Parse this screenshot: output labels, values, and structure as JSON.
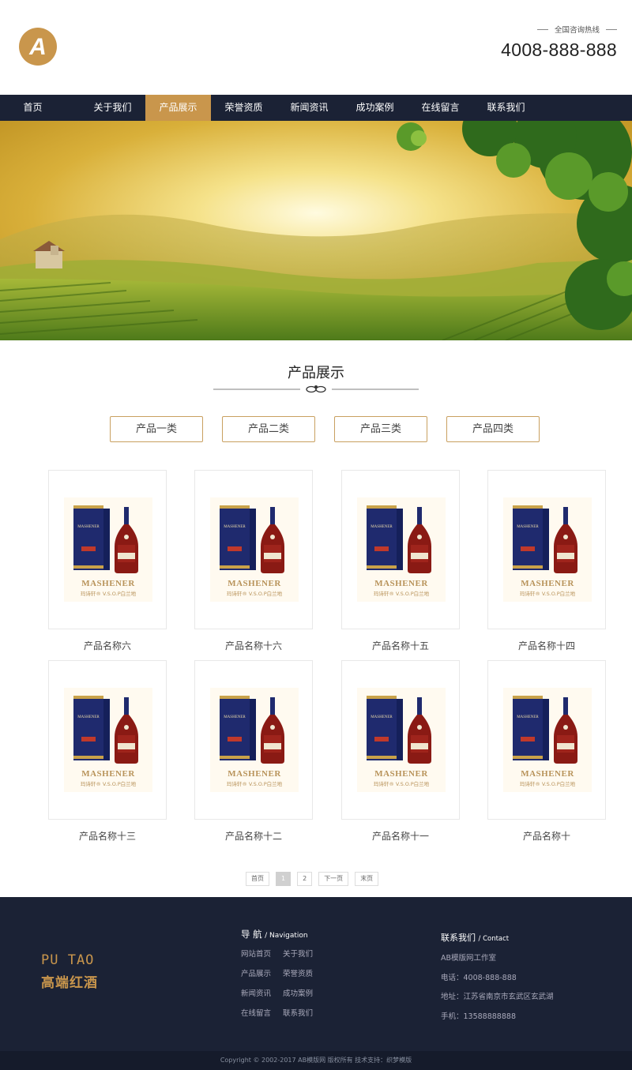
{
  "colors": {
    "accent": "#c9964c",
    "nav_bg": "#1b2235",
    "footer_bg": "#1b2235"
  },
  "header": {
    "logo_letter": "A",
    "hotline_label": "全国咨询热线",
    "hotline_number": "4008-888-888"
  },
  "nav": {
    "items": [
      {
        "label": "首页"
      },
      {
        "label": "关于我们"
      },
      {
        "label": "产品展示",
        "active": true
      },
      {
        "label": "荣誉资质"
      },
      {
        "label": "新闻资讯"
      },
      {
        "label": "成功案例"
      },
      {
        "label": "在线留言"
      },
      {
        "label": "联系我们"
      }
    ]
  },
  "section": {
    "title": "产品展示"
  },
  "categories": [
    "产品一类",
    "产品二类",
    "产品三类",
    "产品四类"
  ],
  "product_image": {
    "brand": "MASHENER",
    "subtitle": "玛诗轩® V.S.O.P白兰地",
    "box_label": "MASHENER"
  },
  "products": [
    {
      "name": "产品名称六"
    },
    {
      "name": "产品名称十六"
    },
    {
      "name": "产品名称十五"
    },
    {
      "name": "产品名称十四"
    },
    {
      "name": "产品名称十三"
    },
    {
      "name": "产品名称十二"
    },
    {
      "name": "产品名称十一"
    },
    {
      "name": "产品名称十"
    }
  ],
  "pagination": {
    "first": "首页",
    "pages": [
      "1",
      "2"
    ],
    "current": "1",
    "next": "下一页",
    "last": "末页"
  },
  "footer": {
    "brand_en": "PU TAO",
    "brand_cn": "高端红酒",
    "nav_title": "导 航",
    "nav_title_en": "/ Navigation",
    "nav_links": [
      "网站首页",
      "关于我们",
      "产品展示",
      "荣誉资质",
      "新闻资讯",
      "成功案例",
      "在线留言",
      "联系我们"
    ],
    "contact_title": "联系我们",
    "contact_title_en": "/ Contact",
    "contact_lines": [
      "AB模版网工作室",
      "电话：4008-888-888",
      "地址：江苏省南京市玄武区玄武湖",
      "手机：13588888888"
    ],
    "copyright": "Copyright © 2002-2017 AB模版网 版权所有 技术支持：织梦模版"
  }
}
